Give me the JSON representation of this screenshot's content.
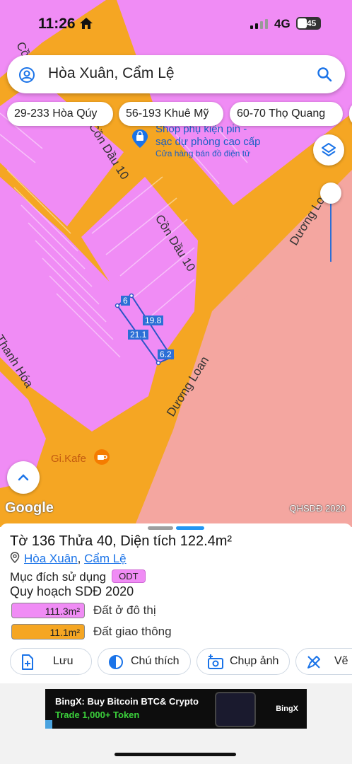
{
  "status_bar": {
    "time": "11:26",
    "network": "4G",
    "battery": "45"
  },
  "search": {
    "query": "Hòa Xuân, Cẩm Lệ"
  },
  "chips": [
    "29-233 Hòa Qúy",
    "56-193 Khuê Mỹ",
    "60-70 Thọ Quang"
  ],
  "map": {
    "roads": {
      "cam_dau_top": "Cồn",
      "cam_dau_10_a": "Cồn Dầu 10",
      "cam_dau_10_b": "Cồn Dầu 10",
      "duong_loan_right": "Dương Loan",
      "duong_loan_center": "Dương Loan",
      "thanh_hoa": "Thanh Hóa"
    },
    "poi": {
      "shop_name_line1": "Shop phụ kiện pin -",
      "shop_name_line2": "sạc dự phòng cao cấp",
      "shop_category": "Cửa hàng bán đồ điện tử",
      "cafe": "Gi.Kafe"
    },
    "parcel_dimensions": {
      "top": "6",
      "right": "19.8",
      "left": "21.1",
      "bottom": "6.2"
    },
    "google_label": "Google",
    "layer_label": "QHSDĐ 2020"
  },
  "parcel": {
    "title": "Tờ 136 Thửa 40, Diện tích 122.4m²",
    "ward": "Hòa Xuân",
    "separator": ",",
    "district": "Cẩm Lệ",
    "purpose_label": "Mục đích sử dụng",
    "purpose_code": "ODT",
    "plan_title": "Quy hoạch SDĐ 2020",
    "legend": [
      {
        "value": "111.3m²",
        "label": "Đất ở đô thị",
        "color": "#f08cf5"
      },
      {
        "value": "11.1m²",
        "label": "Đất giao thông",
        "color": "#f5a623"
      }
    ]
  },
  "actions": {
    "save": "Lưu",
    "legend": "Chú thích",
    "capture": "Chụp ảnh",
    "draw": "Vẽ"
  },
  "ad": {
    "line1": "BingX: Buy Bitcoin BTC& Crypto",
    "line2": "Trade 1,000+ Token",
    "brand": "BingX"
  },
  "colors": {
    "residential": "#f08cf5",
    "road": "#f5a623",
    "other": "#f4a6a0",
    "accent": "#1a73e8"
  }
}
